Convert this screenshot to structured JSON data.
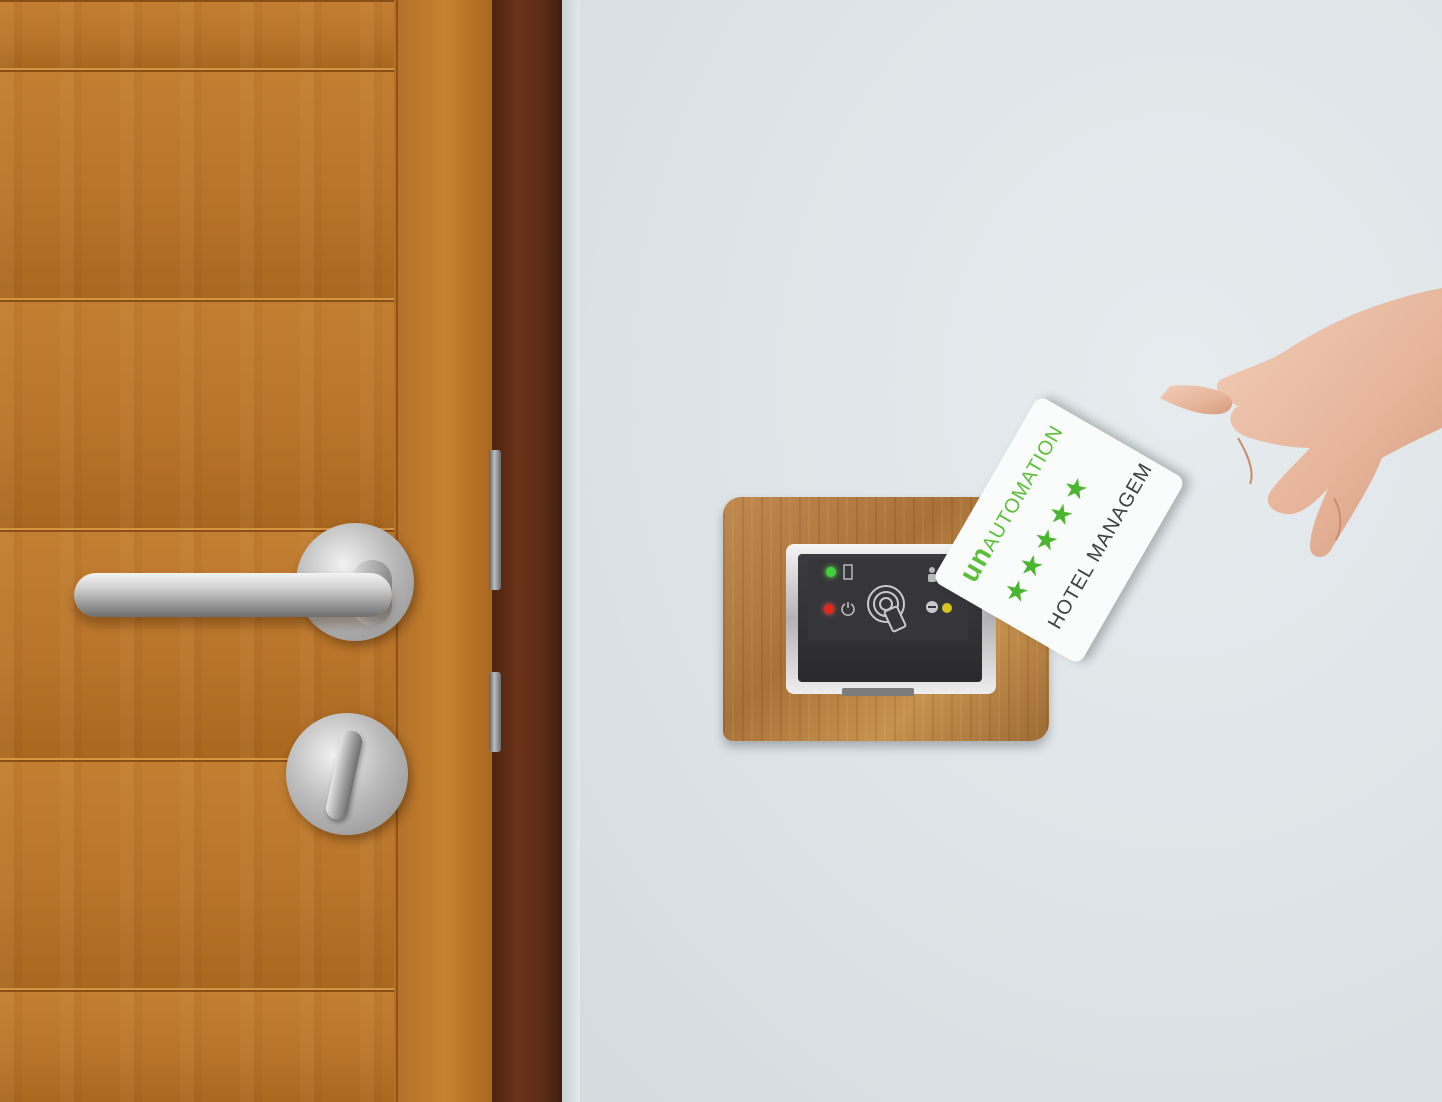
{
  "scene": {
    "description_objects": [
      "door",
      "door-frame",
      "door-lever",
      "thumbturn",
      "wall",
      "card-reader",
      "key-card",
      "hand"
    ]
  },
  "card": {
    "brand_mark": "un",
    "brand_name": "AUTOMATION",
    "label": "HOTEL MANAGEM",
    "stars": [
      "★",
      "★",
      "★",
      "★",
      "★"
    ]
  },
  "colors": {
    "brand_green": "#5bbf3a",
    "led_green": "#3fd23a",
    "led_red": "#e0291b",
    "led_yellow": "#d8c21f"
  }
}
